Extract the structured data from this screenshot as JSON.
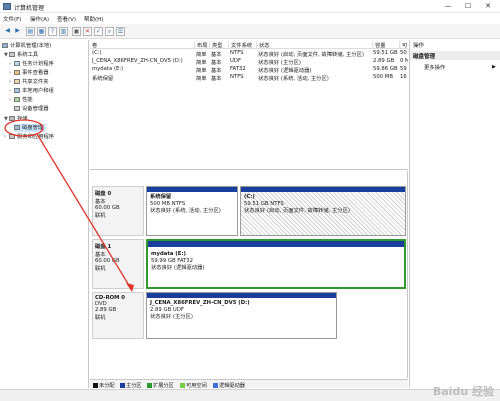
{
  "window": {
    "title": "计算机管理",
    "minimize": "—",
    "maximize": "☐",
    "close": "✕"
  },
  "menu": [
    {
      "label": "文件(F)",
      "x": 3
    },
    {
      "label": "操作(A)",
      "x": 30
    },
    {
      "label": "查看(V)",
      "x": 57
    },
    {
      "label": "帮助(H)",
      "x": 84
    }
  ],
  "tree": {
    "items": [
      {
        "label": "计算机管理(本地)",
        "indent": 0,
        "arrow": ""
      },
      {
        "label": "系统工具",
        "indent": 1,
        "arrow": "▼"
      },
      {
        "label": "任务计划程序",
        "indent": 2,
        "arrow": "›"
      },
      {
        "label": "事件查看器",
        "indent": 2,
        "arrow": "›"
      },
      {
        "label": "共享文件夹",
        "indent": 2,
        "arrow": "›"
      },
      {
        "label": "本地用户和组",
        "indent": 2,
        "arrow": "›"
      },
      {
        "label": "性能",
        "indent": 2,
        "arrow": "›"
      },
      {
        "label": "设备管理器",
        "indent": 2,
        "arrow": ""
      },
      {
        "label": "存储",
        "indent": 1,
        "arrow": "▼"
      },
      {
        "label": "磁盘管理",
        "indent": 2,
        "arrow": "",
        "selected": true
      },
      {
        "label": "服务和应用程序",
        "indent": 1,
        "arrow": "›"
      }
    ]
  },
  "table": {
    "headers": [
      "卷",
      "布局",
      "类型",
      "文件系统",
      "状态",
      "容量",
      "可"
    ],
    "rows": [
      [
        "(C:)",
        "简单",
        "基本",
        "NTFS",
        "状态良好 (启动, 页面文件, 故障转储, 主分区)",
        "59.51 GB",
        "50"
      ],
      [
        "J_CENA_X86FREV_ZH-CN_DV5 (D:)",
        "简单",
        "基本",
        "UDF",
        "状态良好 (主分区)",
        "2.89 GB",
        "0 M"
      ],
      [
        "mydata (E:)",
        "简单",
        "基本",
        "FAT32",
        "状态良好 (逻辑驱动器)",
        "59.86 GB",
        "59"
      ],
      [
        "系统保留",
        "简单",
        "基本",
        "NTFS",
        "状态良好 (系统, 活动, 主分区)",
        "500 MB",
        "16"
      ]
    ]
  },
  "disks": [
    {
      "name": "磁盘 0",
      "type": "基本",
      "size": "60.00 GB",
      "status": "联机",
      "partitions": [
        {
          "name": "系统保留",
          "size": "500 MB NTFS",
          "status": "状态良好 (系统, 活动, 主分区)"
        },
        {
          "name": "(C:)",
          "size": "59.51 GB NTFS",
          "status": "状态良好 (启动, 页面文件, 故障转储, 主分区)"
        }
      ]
    },
    {
      "name": "磁盘 1",
      "type": "基本",
      "size": "60.00 GB",
      "status": "联机",
      "partitions": [
        {
          "name": "mydata (E:)",
          "size": "59.99 GB FAT32",
          "status": "状态良好 (逻辑驱动器)"
        }
      ]
    },
    {
      "name": "CD-ROM 0",
      "type": "DVD",
      "size": "2.89 GB",
      "status": "联机",
      "partitions": [
        {
          "name": "J_CENA_X86FREV_ZH-CN_DV5 (D:)",
          "size": "2.89 GB UDF",
          "status": "状态良好 (主分区)"
        }
      ]
    }
  ],
  "legend": [
    {
      "label": "未分配",
      "color": "#111111"
    },
    {
      "label": "主分区",
      "color": "#1a3e9c"
    },
    {
      "label": "扩展分区",
      "color": "#2e9a2e"
    },
    {
      "label": "可用空间",
      "color": "#7ac943"
    },
    {
      "label": "逻辑驱动器",
      "color": "#3e6dd8"
    }
  ],
  "actions": {
    "header": "操作",
    "section": "磁盘管理",
    "item": "更多操作"
  },
  "watermark": "Baidu 经验",
  "colors": {
    "annotation": "#e0332b",
    "primary": "#1a3e9c",
    "logical": "#2e9a2e",
    "selection": "#cce8ff"
  }
}
